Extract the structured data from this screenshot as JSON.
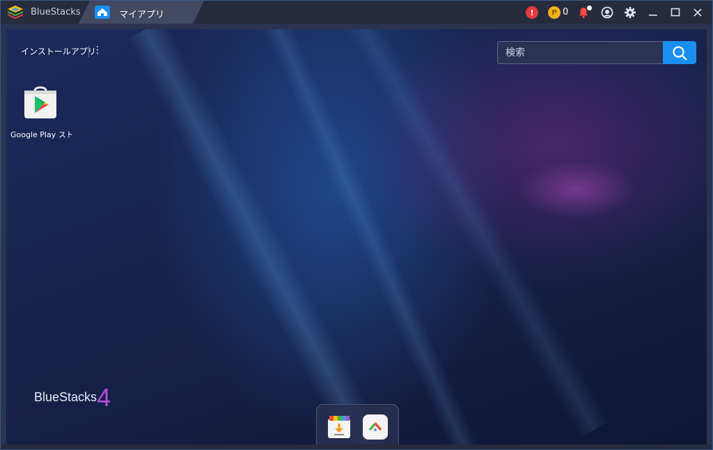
{
  "titlebar": {
    "home_tab_label": "BlueStacks",
    "active_tab_label": "マイアプリ",
    "alert_icon": "alert-icon",
    "coin_count": "0",
    "icons": [
      "alert-icon",
      "coin-icon",
      "notification-bell-icon",
      "account-icon",
      "gear-icon",
      "minimize-icon",
      "maximize-icon",
      "close-icon"
    ]
  },
  "main": {
    "section_label": "インストールアプリ",
    "more_label": "⋮",
    "search": {
      "placeholder": "検索"
    },
    "apps": [
      {
        "name": "Google Play スト",
        "icon": "google-play-store-icon"
      }
    ],
    "brand": {
      "text": "BlueStacks",
      "version": "4"
    }
  },
  "dock": {
    "items": [
      {
        "name": "app-center-icon"
      },
      {
        "name": "game-center-icon"
      }
    ]
  },
  "colors": {
    "accent": "#1a8ff0",
    "titlebar": "#262b3d",
    "alert": "#e53b3b",
    "coin": "#f0b21d",
    "brand_version": "#b24fd6"
  }
}
